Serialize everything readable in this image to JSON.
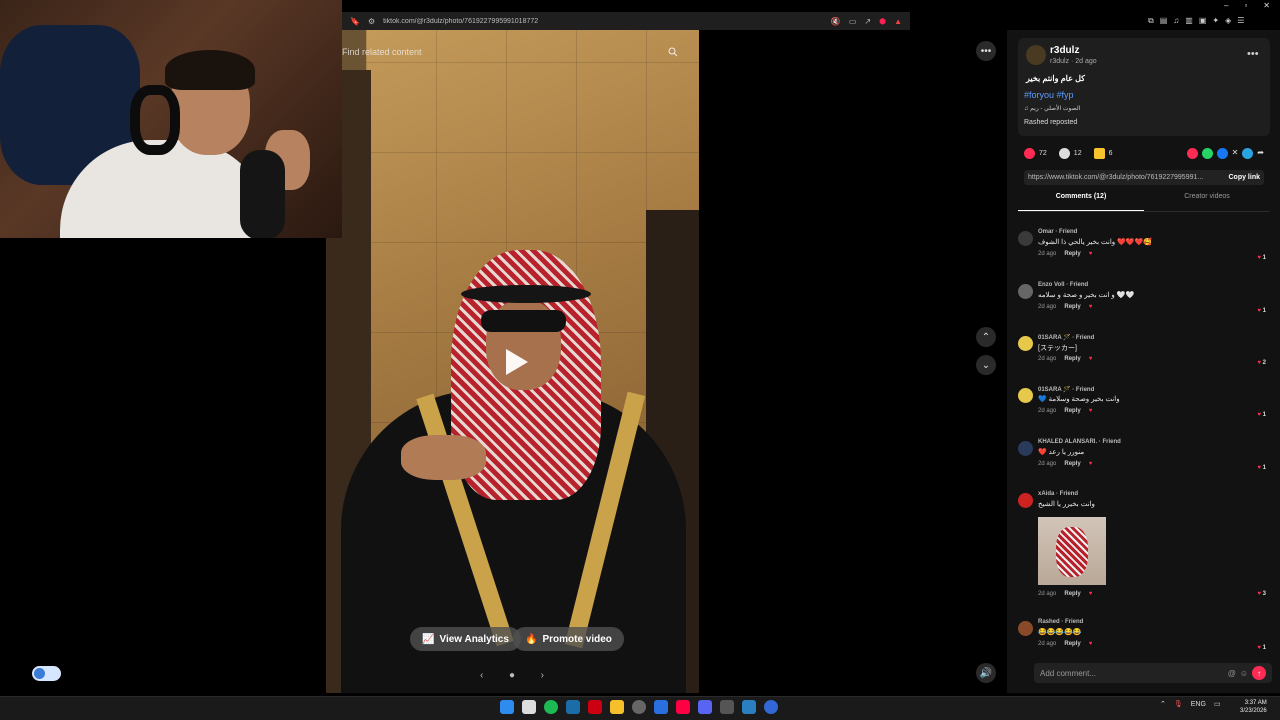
{
  "browser": {
    "url": "tiktok.com/@r3dulz/photo/7619227995991018772"
  },
  "video": {
    "search_placeholder": "Find related content",
    "analytics_label": "View Analytics",
    "promote_label": "Promote video"
  },
  "post": {
    "author": "r3dulz",
    "author_sub": "r3dulz · 2d ago",
    "caption": "كل عام وانتم بخير",
    "hashtags": "#foryou #fyp",
    "sound": "♫  الصوت الأصلي - ريم",
    "repost": "Rashed reposted",
    "likes": "72",
    "comments": "12",
    "saves": "6",
    "link": "https://www.tiktok.com/@r3dulz/photo/7619227995991...",
    "copy_link": "Copy link"
  },
  "tabs": {
    "comments": "Comments (12)",
    "creator_videos": "Creator videos"
  },
  "comments": [
    {
      "name": "Omar · Friend",
      "text": "وانت بخير يالحي ذا الشوف ❤️❤️❤️🥰",
      "time": "2d ago",
      "reply": "Reply",
      "likes": "1",
      "color": "#3a3a3a"
    },
    {
      "name": "Enzo Voll · Friend",
      "text": "و انت بخير و صحة و سلامه 🤍🤍",
      "time": "2d ago",
      "reply": "Reply",
      "likes": "1",
      "color": "#666"
    },
    {
      "name": "01SARA 🪄 · Friend",
      "text": "[ステッカー]",
      "time": "2d ago",
      "reply": "Reply",
      "likes": "2",
      "color": "#e6c84a"
    },
    {
      "name": "01SARA 🪄 · Friend",
      "text": "💙 وانت بخير وصحة وسلامة",
      "time": "2d ago",
      "reply": "Reply",
      "likes": "1",
      "color": "#e6c84a"
    },
    {
      "name": "KHALED ALANSARI. · Friend",
      "text": "❤️ منورر يا رعد",
      "time": "2d ago",
      "reply": "Reply",
      "likes": "1",
      "color": "#2a3a5a"
    },
    {
      "name": "xAida · Friend",
      "text": "وانت بخيرر يا الشيخ",
      "time": "2d ago",
      "reply": "Reply",
      "likes": "3",
      "color": "#c22"
    },
    {
      "name": "Rashed · Friend",
      "text": "😂😂😂😂😂",
      "time": "2d ago",
      "reply": "Reply",
      "likes": "1",
      "color": "#8a4a2a"
    }
  ],
  "compose": {
    "placeholder": "Add comment..."
  },
  "taskbar": {
    "lang": "ENG",
    "time": "3:37 AM",
    "date": "3/23/2026"
  }
}
